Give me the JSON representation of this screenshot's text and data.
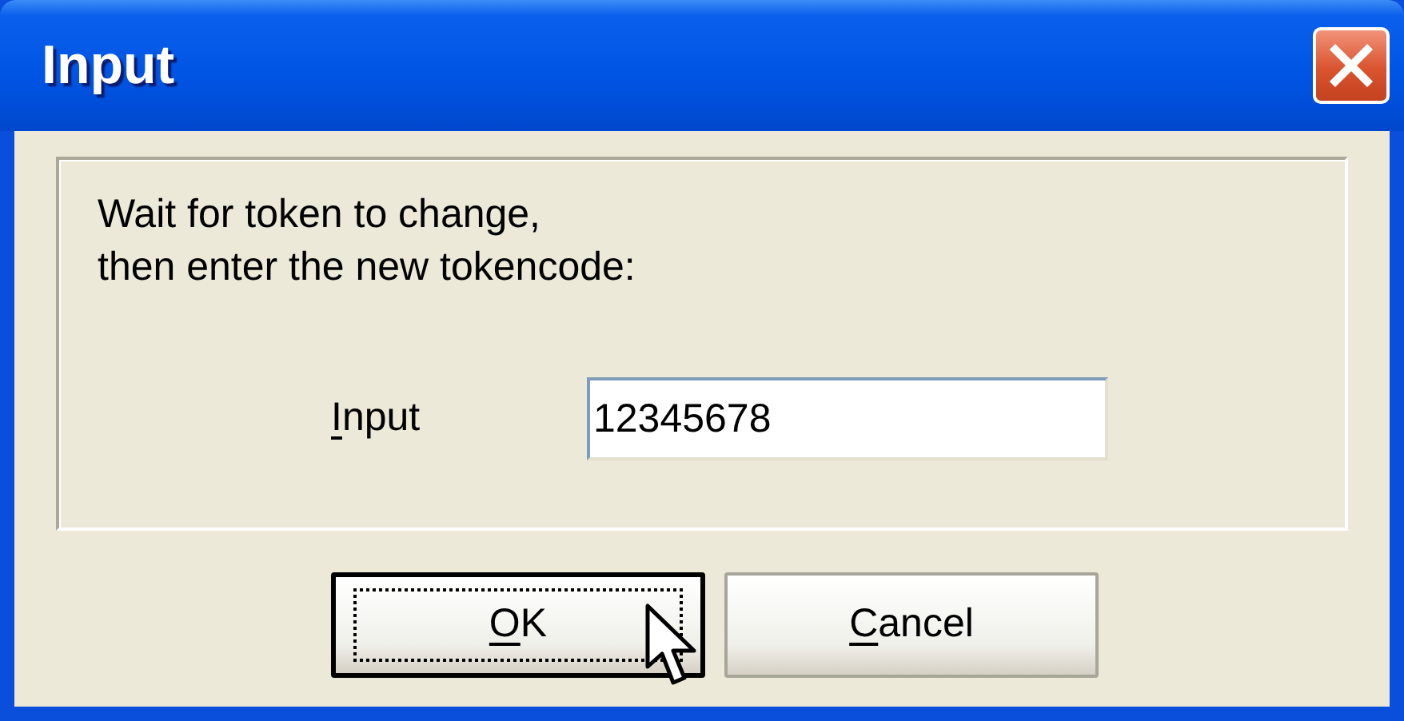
{
  "window": {
    "title": "Input"
  },
  "message": [
    "Wait for token to change,",
    "then enter the new tokencode:"
  ],
  "field": {
    "label": {
      "mnemonic": "I",
      "rest": "nput"
    },
    "value": "12345678"
  },
  "buttons": [
    {
      "mnemonic": "O",
      "rest": "K",
      "focused": true
    },
    {
      "mnemonic": "C",
      "rest": "ancel",
      "focused": false
    }
  ]
}
